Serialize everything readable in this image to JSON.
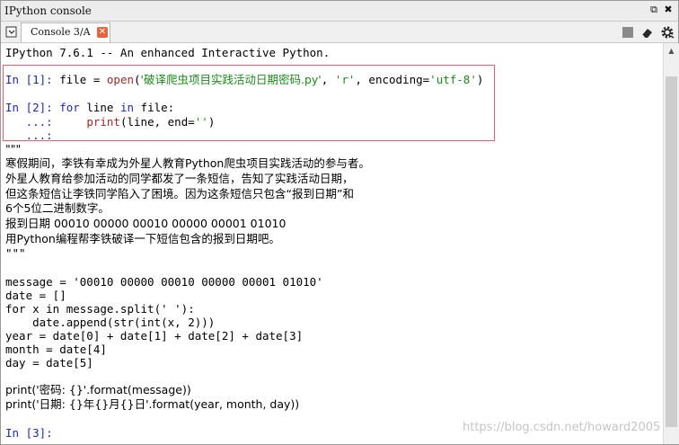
{
  "window": {
    "title": "IPython console",
    "restore_symbol": "⧉",
    "close_symbol": "✖"
  },
  "tab": {
    "label": "Console 3/A",
    "close_symbol": "✕"
  },
  "toolbar": {
    "stop_icon": "stop-square",
    "clear_icon": "eraser",
    "options_icon": "gear"
  },
  "console": {
    "banner": "IPython 7.6.1 -- An enhanced Interactive Python.",
    "in1": {
      "prompt": "In [1]: ",
      "p1": "file = ",
      "fn": "open",
      "p2": "(",
      "s1": "'破译爬虫项目实践活动日期密码.py'",
      "p3": ", ",
      "s2": "'r'",
      "p4": ", encoding=",
      "s3": "'utf-8'",
      "p5": ")"
    },
    "in2": {
      "prompt": "In [2]: ",
      "kw1": "for",
      "p1": " line ",
      "kw2": "in",
      "p2": " file:"
    },
    "cont1": {
      "prompt": "   ...: ",
      "p1": "    ",
      "fn": "print",
      "p2": "(line, end=",
      "s1": "''",
      "p3": ")"
    },
    "cont2": {
      "prompt": "   ...: "
    },
    "output": [
      "\"\"\"",
      "寒假期间，李铁有幸成为外星人教育Python爬虫项目实践活动的参与者。",
      "外星人教育给参加活动的同学都发了一条短信，告知了实践活动日期，",
      "但这条短信让李铁同学陷入了困境。因为这条短信只包含“报到日期”和",
      "6个5位二进制数字。",
      "报到日期 00010 00000 00010 00000 00001 01010",
      "用Python编程帮李铁破译一下短信包含的报到日期吧。",
      "\"\"\"",
      "",
      "message = '00010 00000 00010 00000 00001 01010'",
      "date = []",
      "for x in message.split(' '):",
      "    date.append(str(int(x, 2)))",
      "year = date[0] + date[1] + date[2] + date[3]",
      "month = date[4]",
      "day = date[5]",
      "",
      "print('密码: {}'.format(message))",
      "print('日期: {}年{}月{}日'.format(year, month, day))"
    ],
    "in3": {
      "prompt": "In [3]: "
    }
  },
  "watermark": "https://blog.csdn.net/howard2005",
  "colors": {
    "prompt": "#1a28b8",
    "string": "#1d8a1d",
    "builtin": "#a02a2a",
    "highlight_border": "#e06070",
    "tab_close": "#e8623e"
  }
}
